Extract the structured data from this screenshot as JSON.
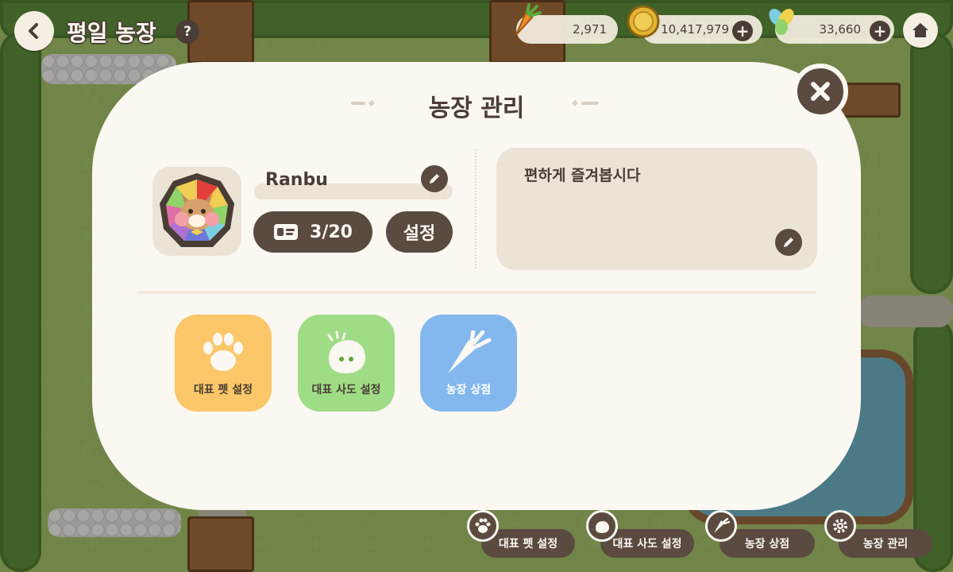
{
  "hud": {
    "farm_title": "평일 농장",
    "guide_glyph": "?",
    "resources": [
      {
        "name": "carrot",
        "value": "2,971",
        "icon": "carrot-icon"
      },
      {
        "name": "coin",
        "value": "10,417,979",
        "icon": "coin-icon"
      },
      {
        "name": "clover",
        "value": "33,660",
        "icon": "clover-icon"
      }
    ],
    "plus_glyph": "+"
  },
  "modal": {
    "title": "농장 관리",
    "profile": {
      "nickname": "Ranbu",
      "visitors": "3/20",
      "settings_label": "설정"
    },
    "intro_text": "편하게 즐겨봅시다",
    "tiles": [
      {
        "label": "대표 펫 설정",
        "color": "#fbc768"
      },
      {
        "label": "대표 사도 설정",
        "color": "#9fdc86"
      },
      {
        "label": "농장 상점",
        "color": "#82b8ee"
      }
    ]
  },
  "bottom_bar": [
    {
      "label": "대표 펫 설정",
      "icon": "paw-icon"
    },
    {
      "label": "대표 사도 설정",
      "icon": "spirit-icon"
    },
    {
      "label": "농장 상점",
      "icon": "carrot-icon"
    },
    {
      "label": "농장 관리",
      "icon": "gear-icon"
    }
  ],
  "colors": {
    "brown": "#5b4a40",
    "cream": "#fbf7f1",
    "panel": "#ebe3d6"
  }
}
